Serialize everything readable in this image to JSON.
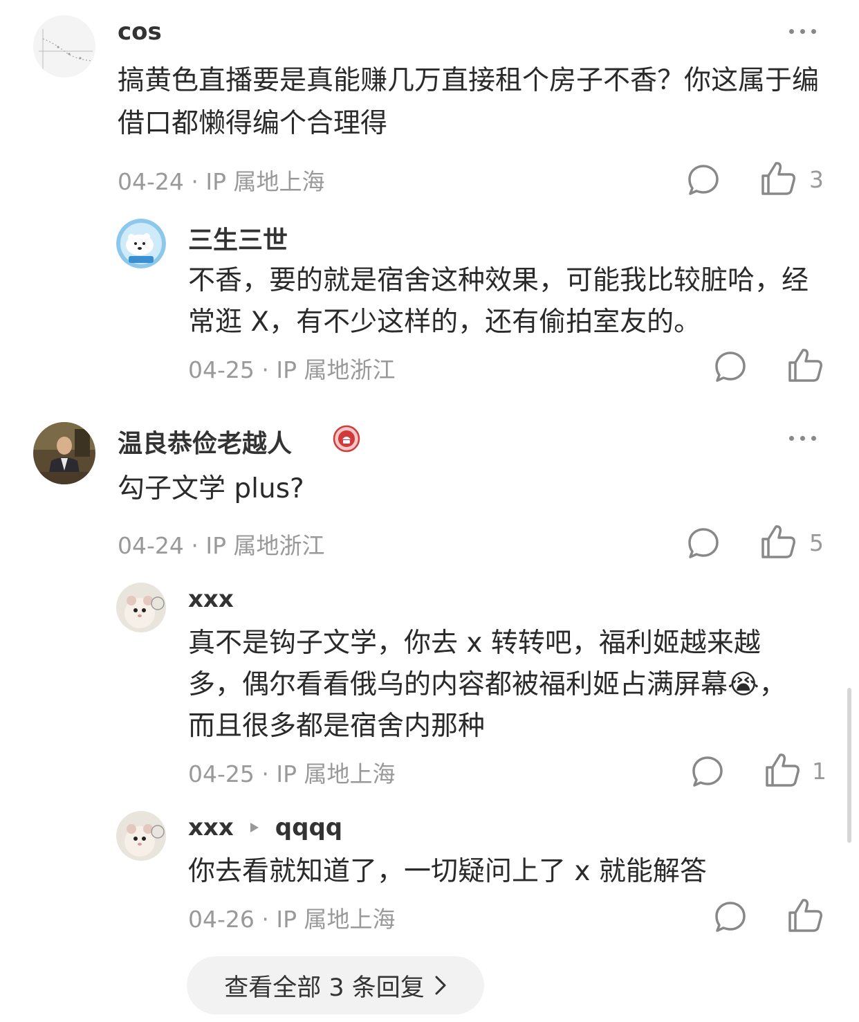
{
  "comments": [
    {
      "user": "cos",
      "text": "搞黄色直播要是真能赚几万直接租个房子不香？你这属于编借口都懒得编个合理得",
      "date": "04-24",
      "ip": "IP 属地上海",
      "likes": "3",
      "avatar_icon": "chart-avatar",
      "replies": [
        {
          "user": "三生三世",
          "text": "不香，要的就是宿舍这种效果，可能我比较脏哈，经常逛 X，有不少这样的，还有偷拍室友的。",
          "date": "04-25",
          "ip": "IP 属地浙江",
          "likes": "",
          "avatar_icon": "polar-bear-avatar"
        }
      ]
    },
    {
      "user": "温良恭俭老越人",
      "badge_icon": "red-badge-icon",
      "text": "勾子文学 plus?",
      "date": "04-24",
      "ip": "IP 属地浙江",
      "likes": "5",
      "avatar_icon": "man-photo-avatar",
      "replies": [
        {
          "user": "xxx",
          "text": "真不是钩子文学，你去 x 转转吧，福利姬越来越多，偶尔看看俄乌的内容都被福利姬占满屏幕😭，而且很多都是宿舍内那种",
          "date": "04-25",
          "ip": "IP 属地上海",
          "likes": "1",
          "avatar_icon": "hamster-avatar"
        },
        {
          "user": "xxx",
          "reply_to": "qqqq",
          "text": "你去看就知道了，一切疑问上了 x 就能解答",
          "date": "04-26",
          "ip": "IP 属地上海",
          "likes": "",
          "avatar_icon": "hamster-avatar"
        }
      ]
    }
  ],
  "view_all": {
    "label": "查看全部 3 条回复"
  },
  "colors": {
    "text": "#2a2a2a",
    "meta": "#999999",
    "icon": "#888888",
    "button_bg": "#f2f2f2"
  }
}
